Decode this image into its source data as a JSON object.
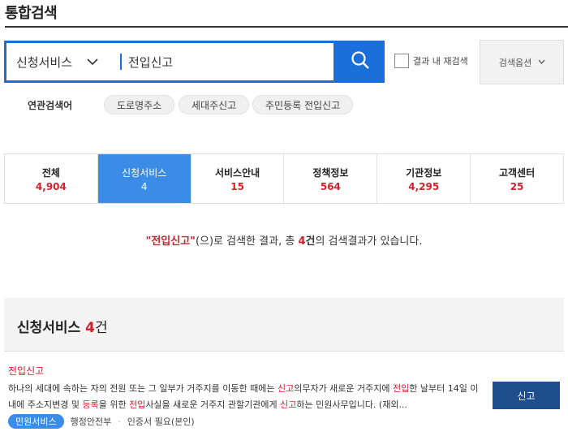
{
  "page": {
    "title": "통합검색"
  },
  "search": {
    "category": "신청서비스",
    "query": "전입신고",
    "recheck_label": "결과 내 재검색",
    "options_label": "검색옵션"
  },
  "related": {
    "label": "연관검색어",
    "chips": [
      "도로명주소",
      "세대주신고",
      "주민등록 전입신고"
    ]
  },
  "tabs": [
    {
      "label": "전체",
      "count": "4,904"
    },
    {
      "label": "신청서비스",
      "count": "4"
    },
    {
      "label": "서비스안내",
      "count": "15"
    },
    {
      "label": "정책정보",
      "count": "564"
    },
    {
      "label": "기관정보",
      "count": "4,295"
    },
    {
      "label": "고객센터",
      "count": "25"
    }
  ],
  "summary": {
    "keyword": "\"전입신고\"",
    "part1": "(으)로 검색한 결과, 총 ",
    "count": "4",
    "unit": "건",
    "part2": "의 검색결과가 있습니다."
  },
  "section": {
    "title": "신청서비스 ",
    "count": "4",
    "unit": "건"
  },
  "result": {
    "title": "전입신고",
    "desc_segments": [
      {
        "t": "하나의 세대에 속하는 자의 전원 또는 그 일부가 거주지를 이동한 때에는 ",
        "hl": false
      },
      {
        "t": "신고",
        "hl": true
      },
      {
        "t": "의무자가 새로운 거주지에 ",
        "hl": false
      },
      {
        "t": "전입",
        "hl": true
      },
      {
        "t": "한 날부터 14일 이내에 주소지변경 및 ",
        "hl": false
      },
      {
        "t": "등록",
        "hl": true
      },
      {
        "t": "을 위한 ",
        "hl": false
      },
      {
        "t": "전입",
        "hl": true
      },
      {
        "t": "사실을 새로운 거주지 관할기관에게 ",
        "hl": false
      },
      {
        "t": "신고",
        "hl": true
      },
      {
        "t": "하는 민원사무입니다. (재외...",
        "hl": false
      }
    ],
    "apply_label": "신고",
    "badge": "민원서비스",
    "agency": "행정안전부",
    "cert": "인증서 필요(본인)"
  },
  "colors": {
    "accent": "#1a6ed8",
    "active_tab": "#3b8ce6",
    "highlight": "#d0202b",
    "apply_button": "#1f4e8c"
  }
}
